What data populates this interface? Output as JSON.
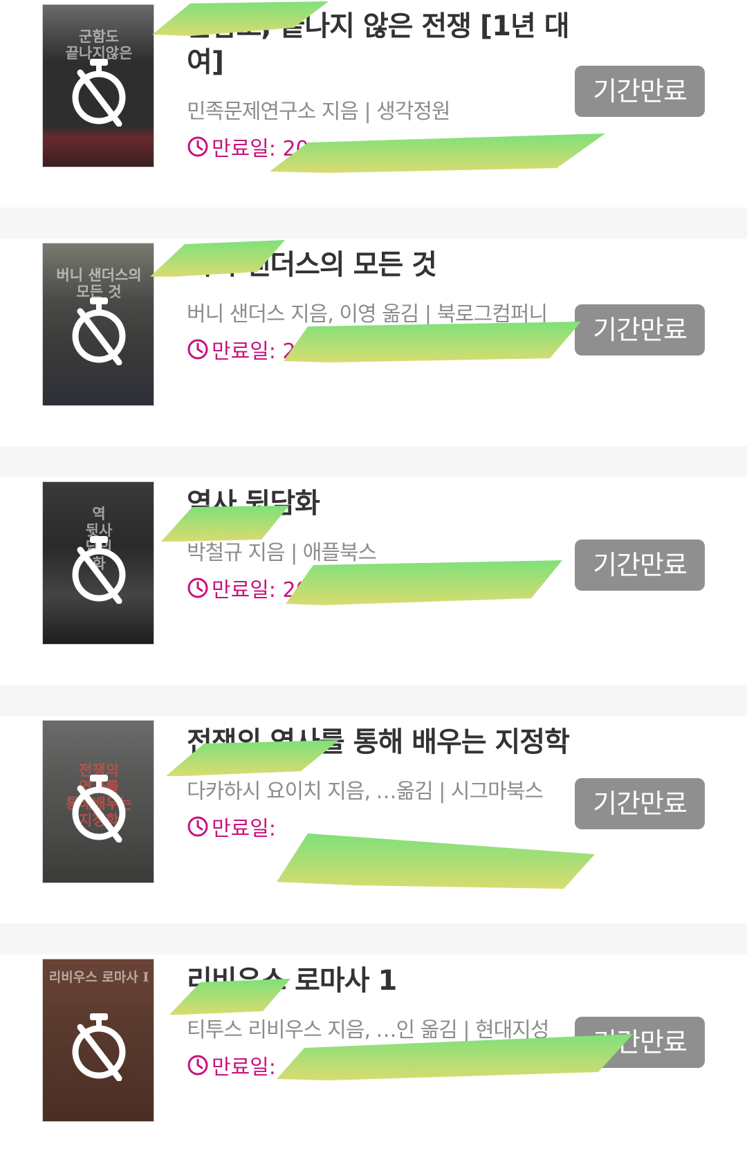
{
  "books": [
    {
      "title": "군함도, 끝나지 않은 전쟁 [1년 대여]",
      "meta": "민족문제연구소 지음 | 생각정원",
      "expire_label": "만료일: 20",
      "status": "기간만료",
      "cover_text": "군함도\n끝나지않은",
      "cover_color": "#3a3a3a"
    },
    {
      "title": "버니 샌더스의 모든 것",
      "meta": "버니 샌더스 지음, 이영 옮김 | 북로그컴퍼니",
      "expire_label": "만료일: 20",
      "status": "기간만료",
      "cover_text": "버니 샌더스의\n모든 것",
      "cover_color": "#4a4a48"
    },
    {
      "title": "역사 뒷담화",
      "meta": "박철규 지음 | 애플북스",
      "expire_label": "만료일: 20",
      "status": "기간만료",
      "cover_text": "역\n뒷사\n담의\n화",
      "cover_color": "#2a2a2a"
    },
    {
      "title": "전쟁의 역사를 통해 배우는 지정학",
      "meta": "다카하시 요이치 지음, …옮김 | 시그마북스",
      "expire_label": "만료일:",
      "status": "기간만료",
      "cover_text": "전쟁의\n역사를\n통해배우는\n지정학",
      "cover_color": "#555553"
    },
    {
      "title": "리비우스 로마사 1",
      "meta": "티투스 리비우스 지음, …인 옮김 | 현대지성",
      "expire_label": "만료일:",
      "status": "기간만료",
      "cover_text": "리비우스 로마사 I",
      "cover_color": "#5a3a2e"
    }
  ],
  "colors": {
    "accent": "#c8127c",
    "status_bg": "#8f8f8f",
    "separator": "#f6f6f6"
  }
}
